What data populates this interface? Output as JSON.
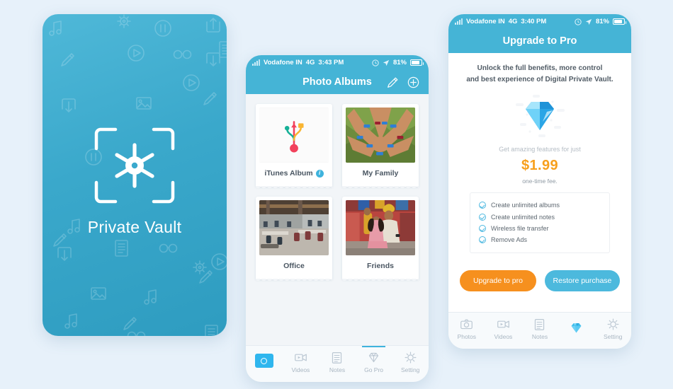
{
  "canvas": {
    "background": "#e7f1fa"
  },
  "splash": {
    "title": "Private Vault",
    "gradient_from": "#4fb8d8",
    "gradient_to": "#2e9cc0",
    "logo_icon": "vault-target-icon",
    "pattern_icons": [
      "music-note-icon",
      "gear-icon",
      "pause-icon",
      "share-icon",
      "image-icon",
      "play-icon",
      "glasses-icon",
      "document-icon",
      "download-icon",
      "pencil-icon"
    ]
  },
  "albums_phone": {
    "status_bar": {
      "signal_icon": "signal-bars-icon",
      "carrier": "Vodafone IN",
      "network": "4G",
      "time": "3:43 PM",
      "alarm_icon": "alarm-icon",
      "location_icon": "location-arrow-icon",
      "battery_percent": "81%",
      "battery_icon": "battery-icon"
    },
    "navbar": {
      "title": "Photo Albums",
      "edit_icon": "pencil-icon",
      "add_icon": "plus-circle-icon"
    },
    "albums": [
      {
        "name": "iTunes Album",
        "thumb": "usb-sync-icon",
        "has_info_badge": true,
        "badge": "i"
      },
      {
        "name": "My Family",
        "thumb": "photo-hands-circle",
        "has_info_badge": false,
        "badge": ""
      },
      {
        "name": "Office",
        "thumb": "photo-office-interior",
        "has_info_badge": false,
        "badge": ""
      },
      {
        "name": "Friends",
        "thumb": "photo-couple-festival",
        "has_info_badge": false,
        "badge": ""
      }
    ],
    "tabs": [
      {
        "label": "",
        "icon": "camera-icon",
        "active": true,
        "underlined": false
      },
      {
        "label": "Videos",
        "icon": "video-icon",
        "active": false,
        "underlined": false
      },
      {
        "label": "Notes",
        "icon": "notes-icon",
        "active": false,
        "underlined": false
      },
      {
        "label": "Go Pro",
        "icon": "diamond-icon",
        "active": false,
        "underlined": true
      },
      {
        "label": "Setting",
        "icon": "gear-icon",
        "active": false,
        "underlined": false
      }
    ]
  },
  "upgrade_phone": {
    "status_bar": {
      "signal_icon": "signal-bars-icon",
      "carrier": "Vodafone IN",
      "network": "4G",
      "time": "3:40 PM",
      "alarm_icon": "alarm-icon",
      "location_icon": "location-arrow-icon",
      "battery_percent": "81%",
      "battery_icon": "battery-icon"
    },
    "navbar": {
      "title": "Upgrade to Pro"
    },
    "subtitle_line1": "Unlock the full benefits, more control",
    "subtitle_line2": "and best experience of Digital Private Vault.",
    "hero_icon": "diamond-icon",
    "get_features_label": "Get amazing features for just",
    "price": "$1.99",
    "price_color": "#f7a01e",
    "fee_note": "one-time fee.",
    "features": [
      "Create unlimited albums",
      "Create unlimited notes",
      "Wireless file transfer",
      "Remove Ads"
    ],
    "buttons": {
      "upgrade_label": "Upgrade to pro",
      "upgrade_color": "#f6901e",
      "restore_label": "Restore purchase",
      "restore_color": "#4cb9dd"
    },
    "tabs": [
      {
        "label": "Photos",
        "icon": "camera-icon",
        "active": false
      },
      {
        "label": "Videos",
        "icon": "video-icon",
        "active": false
      },
      {
        "label": "Notes",
        "icon": "notes-icon",
        "active": false
      },
      {
        "label": "",
        "icon": "diamond-icon",
        "active": true
      },
      {
        "label": "Setting",
        "icon": "gear-icon",
        "active": false
      }
    ]
  }
}
